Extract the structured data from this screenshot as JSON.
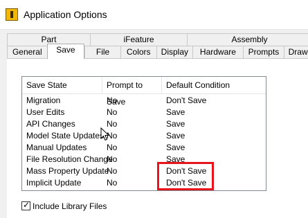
{
  "window": {
    "title": "Application Options"
  },
  "tabs_row1": [
    "Part",
    "iFeature",
    "Assembly"
  ],
  "tabs_row2": [
    "General",
    "Save",
    "File",
    "Colors",
    "Display",
    "Hardware",
    "Prompts",
    "Draw"
  ],
  "active_tab": "Save",
  "table": {
    "columns": [
      "Save State",
      "Prompt to Save",
      "Default Condition"
    ],
    "rows": [
      [
        "Migration",
        "No",
        "Don't Save"
      ],
      [
        "User Edits",
        "No",
        "Save"
      ],
      [
        "API Changes",
        "No",
        "Save"
      ],
      [
        "Model State Updates",
        "No",
        "Save"
      ],
      [
        "Manual Updates",
        "No",
        "Save"
      ],
      [
        "File Resolution Change",
        "No",
        "Save"
      ],
      [
        "Mass Property Update",
        "No",
        "Don't Save"
      ],
      [
        "Implicit Update",
        "No",
        "Don't Save"
      ]
    ]
  },
  "include_library_files": {
    "label": "Include Library Files",
    "checked": true
  },
  "colors": {
    "highlight": "#e8141b",
    "app_icon": "#f2b705"
  }
}
